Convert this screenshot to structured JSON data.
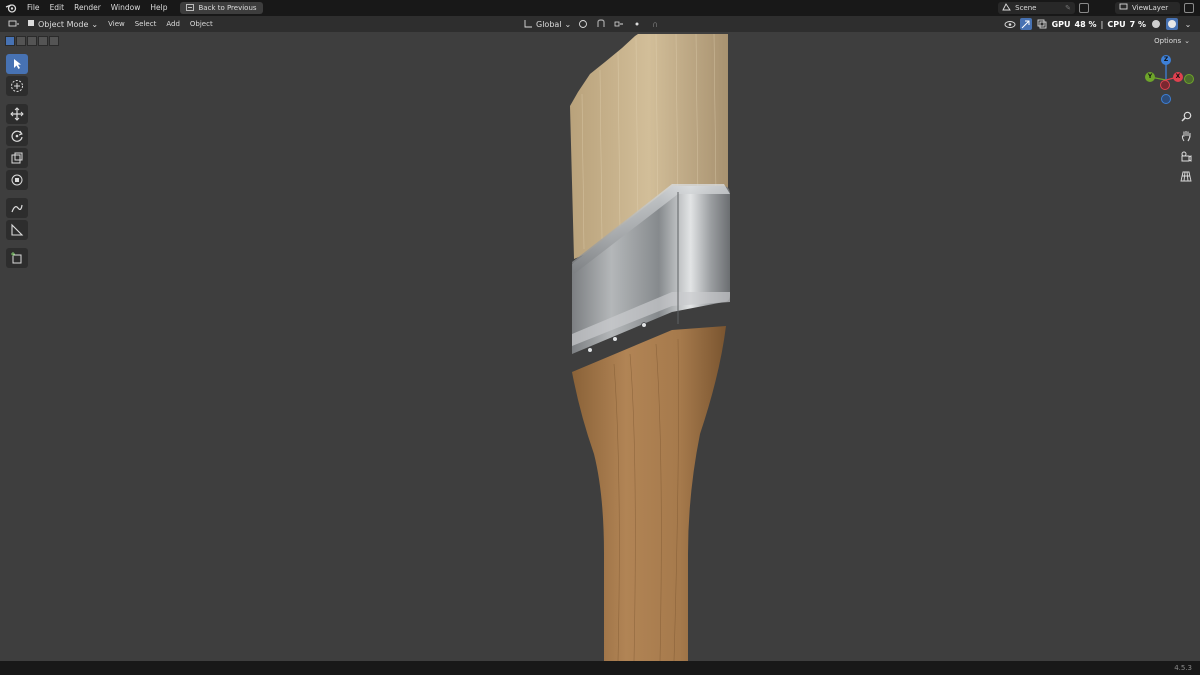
{
  "topbar": {
    "menus": [
      "File",
      "Edit",
      "Render",
      "Window",
      "Help"
    ],
    "back_button": "Back to Previous",
    "scene": "Scene",
    "view_layer": "ViewLayer"
  },
  "viewport_header": {
    "mode": "Object Mode",
    "menus": [
      "View",
      "Select",
      "Add",
      "Object"
    ],
    "transform_orientation": "Global",
    "gpu_label": "GPU",
    "gpu_value": "48 %",
    "cpu_label": "CPU",
    "cpu_value": "7 %",
    "options": "Options"
  },
  "gizmo": {
    "x_label": "X",
    "y_label": "Y",
    "z_label": "Z",
    "x_color": "#e0414f",
    "y_color": "#6ea52a",
    "z_color": "#3d80d8"
  },
  "status": {
    "version": "4.5.3"
  },
  "colors": {
    "accent": "#4772b3",
    "viewport_bg": "#3e3e3e"
  }
}
